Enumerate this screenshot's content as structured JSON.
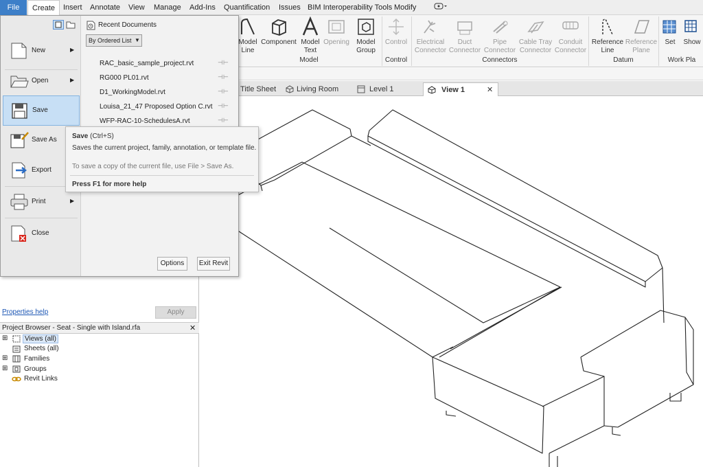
{
  "menubar": {
    "tabs": [
      "File",
      "Create",
      "Insert",
      "Annotate",
      "View",
      "Manage",
      "Add-Ins",
      "Quantification",
      "Issues",
      "BIM Interoperability Tools",
      "Modify"
    ],
    "active": "Create"
  },
  "ribbon": {
    "model_buttons": [
      {
        "label1": "Model",
        "label2": "Line"
      },
      {
        "label1": "Component",
        "label2": ""
      },
      {
        "label1": "Model",
        "label2": "Text"
      },
      {
        "label1": "Opening",
        "label2": ""
      },
      {
        "label1": "Model",
        "label2": "Group"
      }
    ],
    "control_button": "Control",
    "connector_buttons": [
      {
        "label1": "Electrical",
        "label2": "Connector"
      },
      {
        "label1": "Duct",
        "label2": "Connector"
      },
      {
        "label1": "Pipe",
        "label2": "Connector"
      },
      {
        "label1": "Cable Tray",
        "label2": "Connector"
      },
      {
        "label1": "Conduit",
        "label2": "Connector"
      }
    ],
    "datum_buttons": [
      {
        "label1": "Reference",
        "label2": "Line"
      },
      {
        "label1": "Reference",
        "label2": "Plane"
      }
    ],
    "work_buttons": [
      {
        "label1": "Set"
      },
      {
        "label1": "Show"
      }
    ],
    "panels": {
      "model": "Model",
      "control": "Control",
      "connectors": "Connectors",
      "datum": "Datum",
      "work": "Work Pla"
    }
  },
  "viewtabs": [
    {
      "label": "Title Sheet"
    },
    {
      "label": "Living Room"
    },
    {
      "label": "Level 1"
    },
    {
      "label": "View 1",
      "active": true,
      "close": "✕"
    }
  ],
  "appmenu": {
    "items": [
      {
        "label": "New",
        "arrow": "▶"
      },
      {
        "label": "Open",
        "arrow": "▶"
      },
      {
        "label": "Save",
        "arrow": ""
      },
      {
        "label": "Save As",
        "arrow": ""
      },
      {
        "label": "Export",
        "arrow": ""
      },
      {
        "label": "Print",
        "arrow": "▶"
      },
      {
        "label": "Close",
        "arrow": ""
      }
    ],
    "recent_title": "Recent Documents",
    "ordered_list": "By Ordered List",
    "recent_docs": [
      "RAC_basic_sample_project.rvt",
      "RG000 PL01.rvt",
      "D1_WorkingModel.rvt",
      "Louisa_21_47 Proposed Option C.rvt",
      "WFP-RAC-10-SchedulesA.rvt"
    ],
    "options_button": "Options",
    "exit_button": "Exit Revit"
  },
  "tooltip": {
    "title": "Save",
    "shortcut": "(Ctrl+S)",
    "desc": "Saves the current project, family, annotation, or template file.",
    "note": "To save a copy of the current file, use File > Save As.",
    "help": "Press F1 for more help"
  },
  "properties": {
    "help_link": "Properties help",
    "apply_button": "Apply"
  },
  "browser": {
    "title": "Project Browser - Seat - Single with Island.rfa",
    "close": "✕",
    "items": [
      "Views (all)",
      "Sheets (all)",
      "Families",
      "Groups",
      "Revit Links"
    ]
  }
}
